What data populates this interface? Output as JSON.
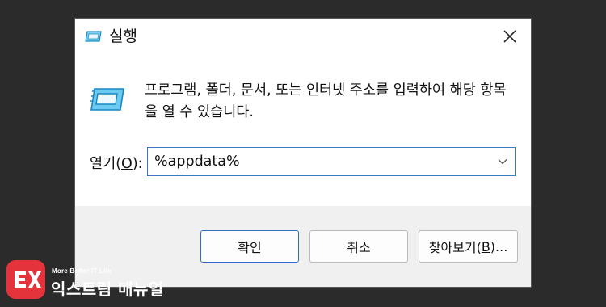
{
  "window": {
    "title": "실행",
    "icon": "run-icon",
    "close_icon": "close-icon"
  },
  "content": {
    "icon": "run-icon",
    "description": "프로그램, 폴더, 문서, 또는 인터넷 주소를 입력하여 해당 항목을 열 수 있습니다."
  },
  "open": {
    "label_prefix": "열기(",
    "label_mnemonic": "O",
    "label_suffix": "):",
    "value": "%appdata%",
    "dropdown_icon": "chevron-down-icon"
  },
  "buttons": {
    "ok": "확인",
    "cancel": "취소",
    "browse_prefix": "찾아보기(",
    "browse_mnemonic": "B",
    "browse_suffix": ")..."
  },
  "watermark": {
    "tagline": "More Better IT Life",
    "name": "익스트림 매뉴얼"
  },
  "colors": {
    "background": "#2b2b2b",
    "accent": "#2d6fc4",
    "footer": "#f0f0f0",
    "brand_red": "#e4333b"
  }
}
